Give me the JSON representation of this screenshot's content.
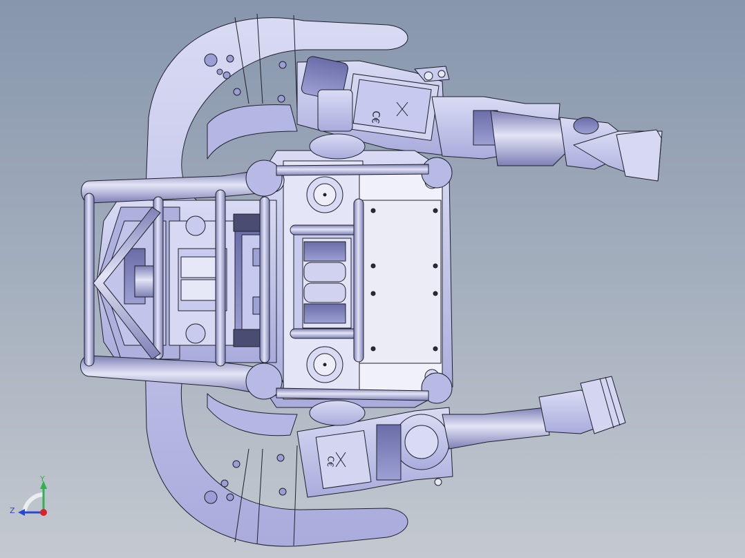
{
  "view": {
    "background_top": "#8796ad",
    "background_bottom": "#c4c9d0",
    "part_fill": "#c5c8ec",
    "part_shade": "#8f93c9",
    "part_light": "#e6e7f7",
    "edge_color": "#1e1f2a"
  },
  "triad": {
    "y_label": "Y",
    "z_label": "Z",
    "y_color": "#2fb34a",
    "z_color": "#2747d6",
    "x_color": "#d9232a"
  }
}
